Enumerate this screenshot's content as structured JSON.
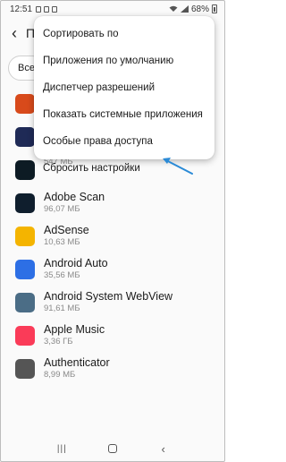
{
  "status_bar": {
    "time": "12:51",
    "battery": "68%"
  },
  "app_bar": {
    "title": "П"
  },
  "filter": {
    "label": "Все"
  },
  "menu": {
    "items": [
      {
        "label": "Сортировать по"
      },
      {
        "label": "Приложения по умолчанию"
      },
      {
        "label": "Диспетчер разрешений"
      },
      {
        "label": "Показать системные приложения"
      },
      {
        "label": "Особые права доступа"
      },
      {
        "label": "Сбросить настройки"
      }
    ]
  },
  "apps": [
    {
      "name": "",
      "size": "",
      "icon": "red-v-app-icon",
      "color": "#d84a1b"
    },
    {
      "name": "",
      "size": "",
      "icon": "pen-app-icon",
      "color": "#1f2a56"
    },
    {
      "name": "",
      "size": "547 МБ",
      "icon": "teal-app-icon",
      "color": "#0d1b24"
    },
    {
      "name": "Adobe Scan",
      "size": "96,07 МБ",
      "icon": "adobe-scan-icon",
      "color": "#0f1e2d"
    },
    {
      "name": "AdSense",
      "size": "10,63 МБ",
      "icon": "adsense-icon",
      "color": "#f4b400"
    },
    {
      "name": "Android Auto",
      "size": "35,56 МБ",
      "icon": "android-auto-icon",
      "color": "#2d6fe5"
    },
    {
      "name": "Android System WebView",
      "size": "91,61 МБ",
      "icon": "gear-icon",
      "color": "#4b6d86"
    },
    {
      "name": "Apple Music",
      "size": "3,36 ГБ",
      "icon": "music-icon",
      "color": "#fa3b58"
    },
    {
      "name": "Authenticator",
      "size": "8,99 МБ",
      "icon": "authenticator-icon",
      "color": "#555555"
    }
  ],
  "colors": {
    "accent_arrow": "#2a8ad6"
  }
}
